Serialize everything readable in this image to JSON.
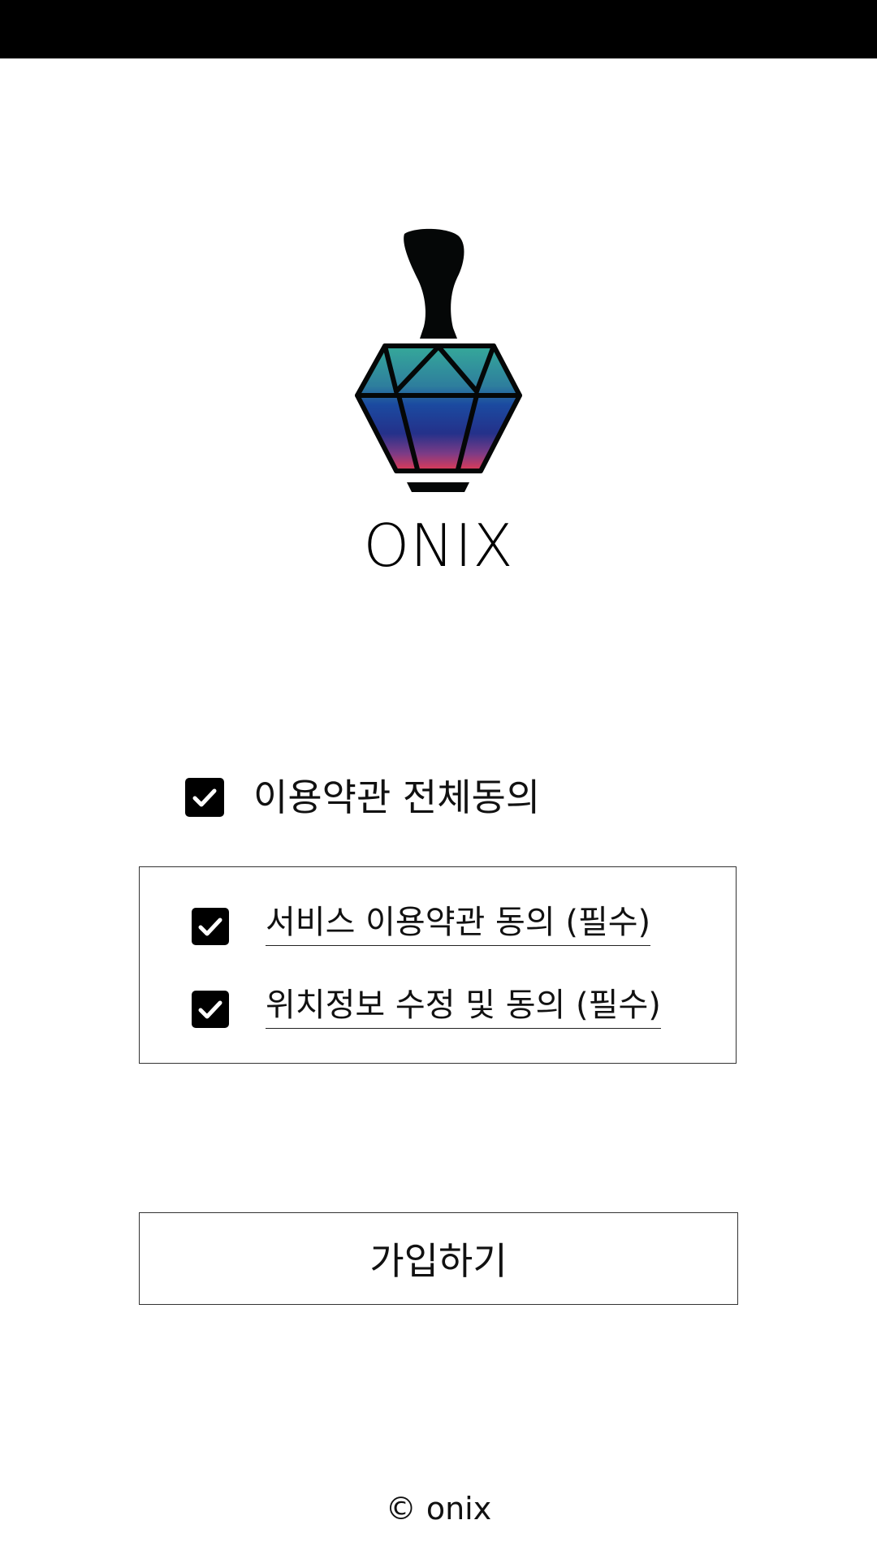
{
  "app": {
    "name": "ONIX",
    "logo_icon": "perfume-bottle-diamond-icon",
    "logo_gradient": [
      "#2f9e8f",
      "#1f4fa0",
      "#1b2f86",
      "#d23a55"
    ]
  },
  "agreement": {
    "all_label": "이용약관 전체동의",
    "all_checked": true,
    "terms": [
      {
        "label": "서비스 이용약관 동의 (필수)",
        "checked": true
      },
      {
        "label": "위치정보 수정 및 동의 (필수)",
        "checked": true
      }
    ]
  },
  "actions": {
    "signup_label": "가입하기"
  },
  "footer": {
    "copyright": "© onix"
  },
  "colors": {
    "status_bar": "#000000",
    "background": "#ffffff",
    "checkbox": "#000000",
    "checkmark": "#ffffff",
    "text": "#111111"
  }
}
